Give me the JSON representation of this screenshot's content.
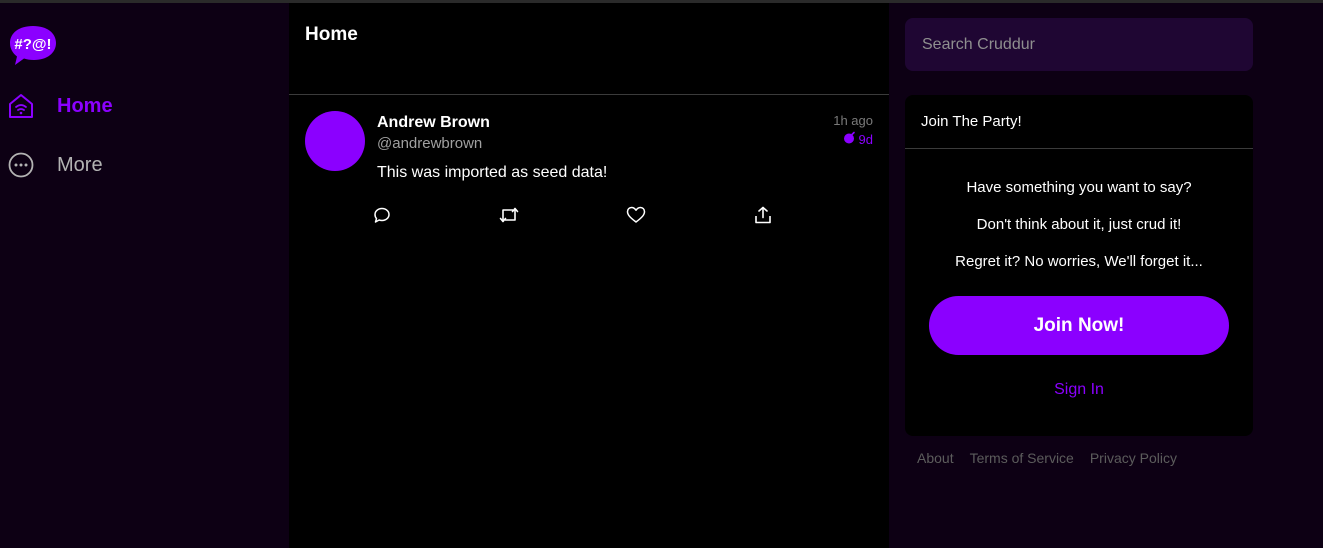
{
  "brand": {
    "logo_text": "#?@!",
    "accent": "#8b00ff"
  },
  "nav": {
    "items": [
      {
        "label": "Home",
        "icon": "home-icon",
        "active": true
      },
      {
        "label": "More",
        "icon": "more-icon",
        "active": false
      }
    ]
  },
  "main": {
    "title": "Home",
    "posts": [
      {
        "display_name": "Andrew Brown",
        "handle": "@andrewbrown",
        "time_ago": "1h ago",
        "expires_in": "9d",
        "message": "This was imported as seed data!"
      }
    ]
  },
  "right": {
    "search_placeholder": "Search Cruddur",
    "join": {
      "title": "Join The Party!",
      "lines": [
        "Have something you want to say?",
        "Don't think about it, just crud it!",
        "Regret it? No worries, We'll forget it..."
      ],
      "button_label": "Join Now!",
      "signin_label": "Sign In"
    },
    "footer": [
      "About",
      "Terms of Service",
      "Privacy Policy"
    ]
  }
}
